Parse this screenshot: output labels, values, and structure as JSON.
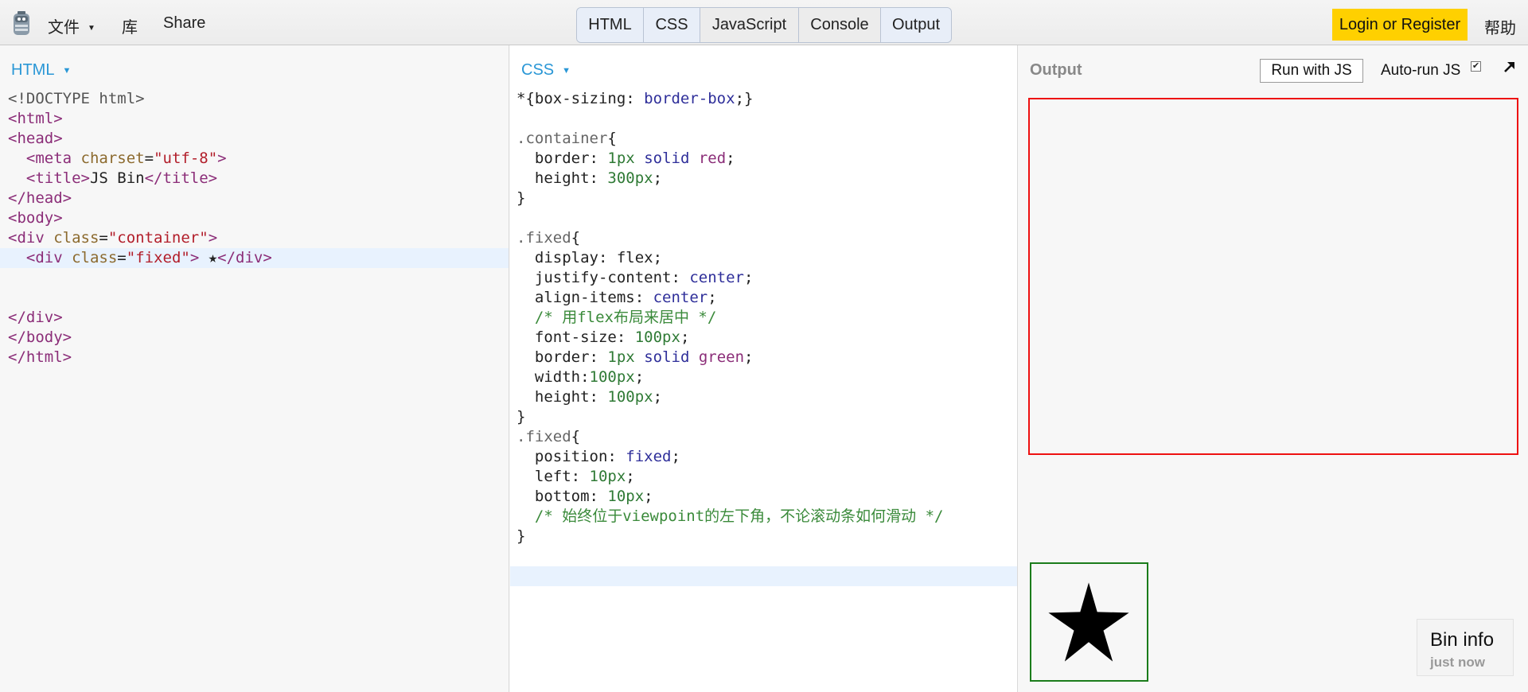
{
  "topbar": {
    "file_label": "文件",
    "library_label": "库",
    "share_label": "Share",
    "tabs": [
      "HTML",
      "CSS",
      "JavaScript",
      "Console",
      "Output"
    ],
    "login_label": "Login or Register",
    "help_label": "帮助"
  },
  "html_panel": {
    "label": "HTML",
    "lines": [
      [
        [
          "t-doc",
          "<!DOCTYPE html>"
        ]
      ],
      [
        [
          "t-tag",
          "<html>"
        ]
      ],
      [
        [
          "t-tag",
          "<head>"
        ]
      ],
      [
        [
          "t-txt",
          "  "
        ],
        [
          "t-tag",
          "<meta "
        ],
        [
          "t-attr",
          "charset"
        ],
        [
          "t-txt",
          "="
        ],
        [
          "t-str",
          "\"utf-8\""
        ],
        [
          "t-tag",
          ">"
        ]
      ],
      [
        [
          "t-txt",
          "  "
        ],
        [
          "t-tag",
          "<title>"
        ],
        [
          "t-txt",
          "JS Bin"
        ],
        [
          "t-tag",
          "</title>"
        ]
      ],
      [
        [
          "t-tag",
          "</head>"
        ]
      ],
      [
        [
          "t-tag",
          "<body>"
        ]
      ],
      [
        [
          "t-tag",
          "<div "
        ],
        [
          "t-attr",
          "class"
        ],
        [
          "t-txt",
          "="
        ],
        [
          "t-str",
          "\"container\""
        ],
        [
          "t-tag",
          ">"
        ]
      ],
      [
        [
          "t-txt",
          "  "
        ],
        [
          "t-tag",
          "<div "
        ],
        [
          "t-attr",
          "class"
        ],
        [
          "t-txt",
          "="
        ],
        [
          "t-str",
          "\"fixed\""
        ],
        [
          "t-tag",
          ">"
        ],
        [
          "t-txt",
          " ★"
        ],
        [
          "t-tag",
          "</div>"
        ]
      ],
      [],
      [],
      [
        [
          "t-tag",
          "</div>"
        ]
      ],
      [
        [
          "t-tag",
          "</body>"
        ]
      ],
      [
        [
          "t-tag",
          "</html>"
        ]
      ]
    ],
    "active_line": 8
  },
  "css_panel": {
    "label": "CSS",
    "lines": [
      [
        [
          "c-br",
          "*{"
        ],
        [
          "c-prop",
          "box-sizing"
        ],
        [
          "c-br",
          ": "
        ],
        [
          "c-kw",
          "border-box"
        ],
        [
          "c-br",
          ";}"
        ]
      ],
      [],
      [
        [
          "c-sel",
          ".container"
        ],
        [
          "c-br",
          "{"
        ]
      ],
      [
        [
          "c-prop",
          "  border"
        ],
        [
          "c-br",
          ": "
        ],
        [
          "c-num",
          "1px"
        ],
        [
          "c-br",
          " "
        ],
        [
          "c-kw",
          "solid"
        ],
        [
          "c-br",
          " "
        ],
        [
          "c-color",
          "red"
        ],
        [
          "c-br",
          ";"
        ]
      ],
      [
        [
          "c-prop",
          "  height"
        ],
        [
          "c-br",
          ": "
        ],
        [
          "c-num",
          "300px"
        ],
        [
          "c-br",
          ";"
        ]
      ],
      [
        [
          "c-br",
          "}"
        ]
      ],
      [],
      [
        [
          "c-sel",
          ".fixed"
        ],
        [
          "c-br",
          "{"
        ]
      ],
      [
        [
          "c-prop",
          "  display"
        ],
        [
          "c-br",
          ": flex;"
        ]
      ],
      [
        [
          "c-prop",
          "  justify-content"
        ],
        [
          "c-br",
          ": "
        ],
        [
          "c-kw",
          "center"
        ],
        [
          "c-br",
          ";"
        ]
      ],
      [
        [
          "c-prop",
          "  align-items"
        ],
        [
          "c-br",
          ": "
        ],
        [
          "c-kw",
          "center"
        ],
        [
          "c-br",
          ";"
        ]
      ],
      [
        [
          "c-com",
          "  /* 用flex布局来居中 */"
        ]
      ],
      [
        [
          "c-prop",
          "  font-size"
        ],
        [
          "c-br",
          ": "
        ],
        [
          "c-num",
          "100px"
        ],
        [
          "c-br",
          ";"
        ]
      ],
      [
        [
          "c-prop",
          "  border"
        ],
        [
          "c-br",
          ": "
        ],
        [
          "c-num",
          "1px"
        ],
        [
          "c-br",
          " "
        ],
        [
          "c-kw",
          "solid"
        ],
        [
          "c-br",
          " "
        ],
        [
          "c-color",
          "green"
        ],
        [
          "c-br",
          ";"
        ]
      ],
      [
        [
          "c-prop",
          "  width"
        ],
        [
          "c-br",
          ":"
        ],
        [
          "c-num",
          "100px"
        ],
        [
          "c-br",
          ";"
        ]
      ],
      [
        [
          "c-prop",
          "  height"
        ],
        [
          "c-br",
          ": "
        ],
        [
          "c-num",
          "100px"
        ],
        [
          "c-br",
          ";"
        ]
      ],
      [
        [
          "c-br",
          "}"
        ]
      ],
      [
        [
          "c-sel",
          ".fixed"
        ],
        [
          "c-br",
          "{"
        ]
      ],
      [
        [
          "c-prop",
          "  position"
        ],
        [
          "c-br",
          ": "
        ],
        [
          "c-kw",
          "fixed"
        ],
        [
          "c-br",
          ";"
        ]
      ],
      [
        [
          "c-prop",
          "  left"
        ],
        [
          "c-br",
          ": "
        ],
        [
          "c-num",
          "10px"
        ],
        [
          "c-br",
          ";"
        ]
      ],
      [
        [
          "c-prop",
          "  bottom"
        ],
        [
          "c-br",
          ": "
        ],
        [
          "c-num",
          "10px"
        ],
        [
          "c-br",
          ";"
        ]
      ],
      [
        [
          "c-com",
          "  /* 始终位于viewpoint的左下角，不论滚动条如何滑动 */"
        ]
      ],
      [
        [
          "c-br",
          "}"
        ]
      ],
      [],
      []
    ],
    "active_line": 24
  },
  "output_panel": {
    "label": "Output",
    "run_label": "Run with JS",
    "autorun_label": "Auto-run JS",
    "autorun_checked": true,
    "star_glyph": "★"
  },
  "bin_info": {
    "title": "Bin info",
    "time": "just now"
  },
  "colors": {
    "login_bg": "#ffd000",
    "panel_label": "#2a97d6",
    "output_container_border": "#ee1111",
    "output_fixed_border": "#1b7c1b"
  }
}
